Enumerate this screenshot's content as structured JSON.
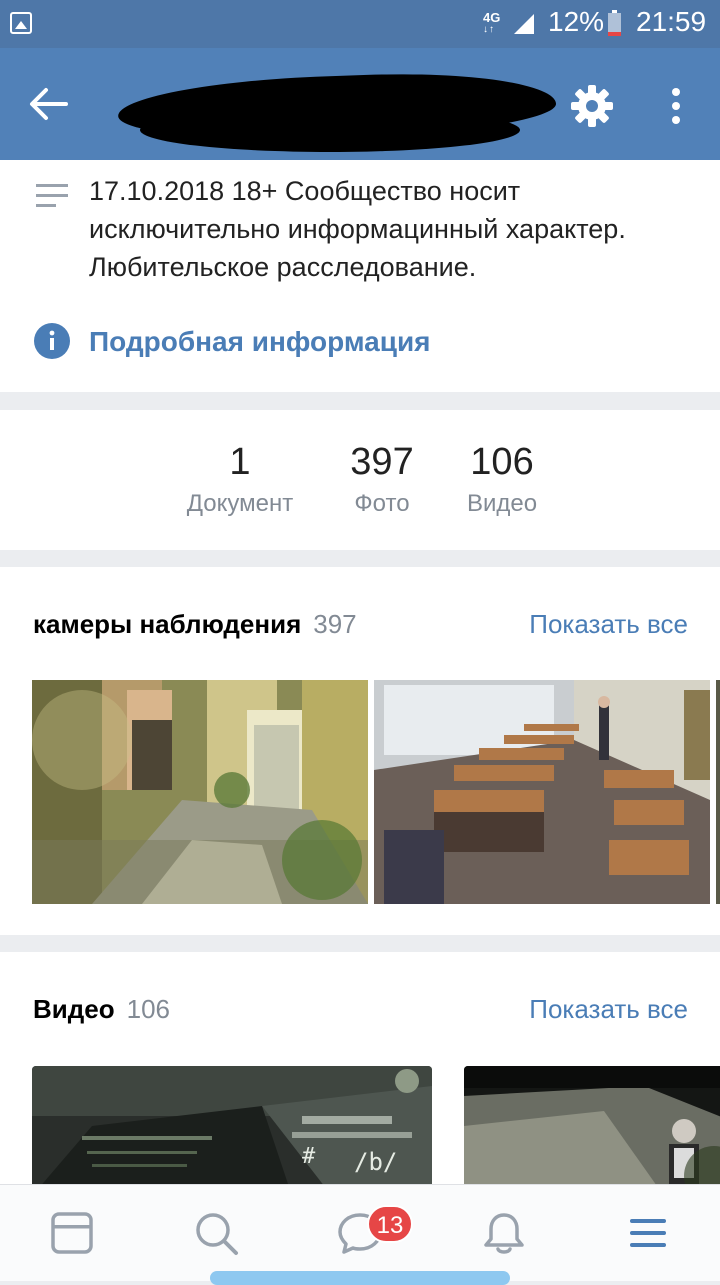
{
  "status_bar": {
    "network": "4G",
    "battery": "12%",
    "time": "21:59"
  },
  "header": {
    "back_icon": "arrow-left-icon",
    "settings_icon": "gear-icon",
    "more_icon": "more-vertical-icon"
  },
  "info": {
    "description": "17.10.2018 18+ Сообщество носит исключительно информацинный характер. Любительское расследование.",
    "more_info": "Подробная информация"
  },
  "counters": [
    {
      "value": "1",
      "label": "Документ"
    },
    {
      "value": "397",
      "label": "Фото"
    },
    {
      "value": "106",
      "label": "Видео"
    }
  ],
  "album": {
    "title": "камеры наблюдения",
    "count": "397",
    "show_all": "Показать все"
  },
  "videos": {
    "title": "Видео",
    "count": "106",
    "show_all": "Показать все",
    "overlay_text": "/b/",
    "overlay_hash": "#"
  },
  "bottom_nav": {
    "messages_badge": "13"
  },
  "colors": {
    "header": "#5181b8",
    "status_bar": "#4e77a8",
    "accent": "#4a7db6",
    "badge": "#e64646"
  }
}
